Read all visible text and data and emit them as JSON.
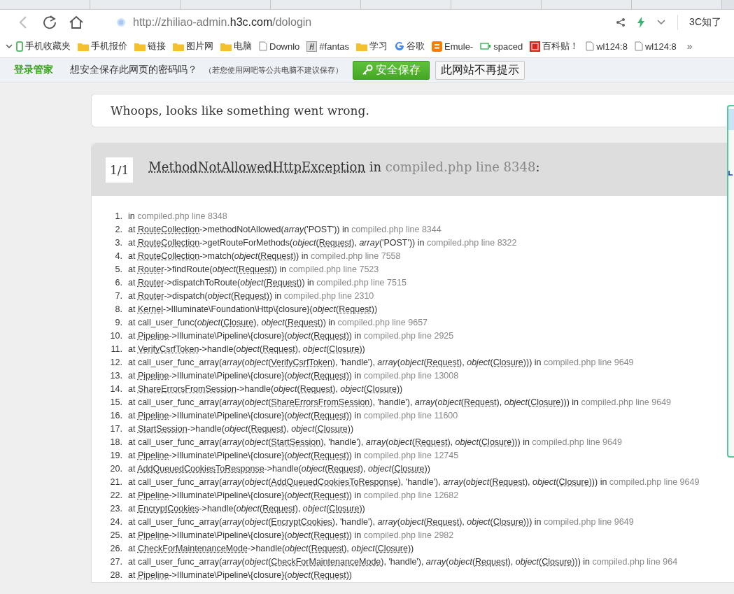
{
  "address_bar": {
    "url_scheme": "http://zhiliao-admin.",
    "url_domain": "h3c.com",
    "url_path": "/dologin",
    "search_text": "3C知了"
  },
  "bookmarks": [
    {
      "kind": "phone",
      "label": "手机收藏夹"
    },
    {
      "kind": "folder",
      "label": "手机报价"
    },
    {
      "kind": "folder",
      "label": "链接"
    },
    {
      "kind": "folder",
      "label": "图片网"
    },
    {
      "kind": "folder",
      "label": "电脑"
    },
    {
      "kind": "page",
      "label": "Downlo"
    },
    {
      "kind": "script",
      "label": "#fantas"
    },
    {
      "kind": "folder",
      "label": "学习"
    },
    {
      "kind": "google",
      "label": "谷歌"
    },
    {
      "kind": "blog",
      "label": "Emule-"
    },
    {
      "kind": "device",
      "label": "spaced"
    },
    {
      "kind": "stamp",
      "label": "百科贴！"
    },
    {
      "kind": "page",
      "label": "wl124:8"
    },
    {
      "kind": "page",
      "label": "wl124:8"
    }
  ],
  "bookmarks_more": "»",
  "password_bar": {
    "brand": "登录管家",
    "question": "想安全保存此网页的密码吗？",
    "hint": "（若您使用网吧等公共电脑不建议保存）",
    "save_button": "安全保存",
    "never_button": "此网站不再提示"
  },
  "error_page": {
    "headline": "Whoops, looks like something went wrong.",
    "counter": "1/1",
    "exception": "MethodNotAllowedHttpException",
    "exception_in": " in ",
    "exception_location": "compiled.php line 8348",
    "exception_colon": ":",
    "frames": [
      {
        "number": "1.",
        "parts": [
          {
            "kind": "plain",
            "text": "in "
          },
          {
            "kind": "file",
            "text": "compiled.php line 8348"
          }
        ]
      },
      {
        "number": "2.",
        "parts": [
          {
            "kind": "plain",
            "text": "at "
          },
          {
            "kind": "class",
            "text": "RouteCollection"
          },
          {
            "kind": "plain",
            "text": "->methodNotAllowed("
          },
          {
            "kind": "type",
            "text": "array"
          },
          {
            "kind": "plain",
            "text": "('POST')) in "
          },
          {
            "kind": "file",
            "text": "compiled.php line 8344"
          }
        ]
      },
      {
        "number": "3.",
        "parts": [
          {
            "kind": "plain",
            "text": "at "
          },
          {
            "kind": "class",
            "text": "RouteCollection"
          },
          {
            "kind": "plain",
            "text": "->getRouteForMethods("
          },
          {
            "kind": "type",
            "text": "object"
          },
          {
            "kind": "plain",
            "text": "("
          },
          {
            "kind": "class",
            "text": "Request"
          },
          {
            "kind": "plain",
            "text": "), "
          },
          {
            "kind": "type",
            "text": "array"
          },
          {
            "kind": "plain",
            "text": "('POST')) in "
          },
          {
            "kind": "file",
            "text": "compiled.php line 8322"
          }
        ]
      },
      {
        "number": "4.",
        "parts": [
          {
            "kind": "plain",
            "text": "at "
          },
          {
            "kind": "class",
            "text": "RouteCollection"
          },
          {
            "kind": "plain",
            "text": "->match("
          },
          {
            "kind": "type",
            "text": "object"
          },
          {
            "kind": "plain",
            "text": "("
          },
          {
            "kind": "class",
            "text": "Request"
          },
          {
            "kind": "plain",
            "text": ")) in "
          },
          {
            "kind": "file",
            "text": "compiled.php line 7558"
          }
        ]
      },
      {
        "number": "5.",
        "parts": [
          {
            "kind": "plain",
            "text": "at "
          },
          {
            "kind": "class",
            "text": "Router"
          },
          {
            "kind": "plain",
            "text": "->findRoute("
          },
          {
            "kind": "type",
            "text": "object"
          },
          {
            "kind": "plain",
            "text": "("
          },
          {
            "kind": "class",
            "text": "Request"
          },
          {
            "kind": "plain",
            "text": ")) in "
          },
          {
            "kind": "file",
            "text": "compiled.php line 7523"
          }
        ]
      },
      {
        "number": "6.",
        "parts": [
          {
            "kind": "plain",
            "text": "at "
          },
          {
            "kind": "class",
            "text": "Router"
          },
          {
            "kind": "plain",
            "text": "->dispatchToRoute("
          },
          {
            "kind": "type",
            "text": "object"
          },
          {
            "kind": "plain",
            "text": "("
          },
          {
            "kind": "class",
            "text": "Request"
          },
          {
            "kind": "plain",
            "text": ")) in "
          },
          {
            "kind": "file",
            "text": "compiled.php line 7515"
          }
        ]
      },
      {
        "number": "7.",
        "parts": [
          {
            "kind": "plain",
            "text": "at "
          },
          {
            "kind": "class",
            "text": "Router"
          },
          {
            "kind": "plain",
            "text": "->dispatch("
          },
          {
            "kind": "type",
            "text": "object"
          },
          {
            "kind": "plain",
            "text": "("
          },
          {
            "kind": "class",
            "text": "Request"
          },
          {
            "kind": "plain",
            "text": ")) in "
          },
          {
            "kind": "file",
            "text": "compiled.php line 2310"
          }
        ]
      },
      {
        "number": "8.",
        "parts": [
          {
            "kind": "plain",
            "text": "at "
          },
          {
            "kind": "class",
            "text": "Kernel"
          },
          {
            "kind": "plain",
            "text": "->Illuminate\\Foundation\\Http\\{closure}("
          },
          {
            "kind": "type",
            "text": "object"
          },
          {
            "kind": "plain",
            "text": "("
          },
          {
            "kind": "class",
            "text": "Request"
          },
          {
            "kind": "plain",
            "text": "))"
          }
        ]
      },
      {
        "number": "9.",
        "parts": [
          {
            "kind": "plain",
            "text": "at call_user_func("
          },
          {
            "kind": "type",
            "text": "object"
          },
          {
            "kind": "plain",
            "text": "("
          },
          {
            "kind": "class",
            "text": "Closure"
          },
          {
            "kind": "plain",
            "text": "), "
          },
          {
            "kind": "type",
            "text": "object"
          },
          {
            "kind": "plain",
            "text": "("
          },
          {
            "kind": "class",
            "text": "Request"
          },
          {
            "kind": "plain",
            "text": ")) in "
          },
          {
            "kind": "file",
            "text": "compiled.php line 9657"
          }
        ]
      },
      {
        "number": "10.",
        "parts": [
          {
            "kind": "plain",
            "text": "at "
          },
          {
            "kind": "class",
            "text": "Pipeline"
          },
          {
            "kind": "plain",
            "text": "->Illuminate\\Pipeline\\{closure}("
          },
          {
            "kind": "type",
            "text": "object"
          },
          {
            "kind": "plain",
            "text": "("
          },
          {
            "kind": "class",
            "text": "Request"
          },
          {
            "kind": "plain",
            "text": ")) in "
          },
          {
            "kind": "file",
            "text": "compiled.php line 2925"
          }
        ]
      },
      {
        "number": "11.",
        "parts": [
          {
            "kind": "plain",
            "text": "at "
          },
          {
            "kind": "class",
            "text": "VerifyCsrfToken"
          },
          {
            "kind": "plain",
            "text": "->handle("
          },
          {
            "kind": "type",
            "text": "object"
          },
          {
            "kind": "plain",
            "text": "("
          },
          {
            "kind": "class",
            "text": "Request"
          },
          {
            "kind": "plain",
            "text": "), "
          },
          {
            "kind": "type",
            "text": "object"
          },
          {
            "kind": "plain",
            "text": "("
          },
          {
            "kind": "class",
            "text": "Closure"
          },
          {
            "kind": "plain",
            "text": "))"
          }
        ]
      },
      {
        "number": "12.",
        "parts": [
          {
            "kind": "plain",
            "text": "at call_user_func_array("
          },
          {
            "kind": "type",
            "text": "array"
          },
          {
            "kind": "plain",
            "text": "("
          },
          {
            "kind": "type",
            "text": "object"
          },
          {
            "kind": "plain",
            "text": "("
          },
          {
            "kind": "class",
            "text": "VerifyCsrfToken"
          },
          {
            "kind": "plain",
            "text": "), 'handle'), "
          },
          {
            "kind": "type",
            "text": "array"
          },
          {
            "kind": "plain",
            "text": "("
          },
          {
            "kind": "type",
            "text": "object"
          },
          {
            "kind": "plain",
            "text": "("
          },
          {
            "kind": "class",
            "text": "Request"
          },
          {
            "kind": "plain",
            "text": "), "
          },
          {
            "kind": "type",
            "text": "object"
          },
          {
            "kind": "plain",
            "text": "("
          },
          {
            "kind": "class",
            "text": "Closure"
          },
          {
            "kind": "plain",
            "text": "))) in "
          },
          {
            "kind": "file",
            "text": "compiled.php line 9649"
          }
        ]
      },
      {
        "number": "13.",
        "parts": [
          {
            "kind": "plain",
            "text": "at "
          },
          {
            "kind": "class",
            "text": "Pipeline"
          },
          {
            "kind": "plain",
            "text": "->Illuminate\\Pipeline\\{closure}("
          },
          {
            "kind": "type",
            "text": "object"
          },
          {
            "kind": "plain",
            "text": "("
          },
          {
            "kind": "class",
            "text": "Request"
          },
          {
            "kind": "plain",
            "text": ")) in "
          },
          {
            "kind": "file",
            "text": "compiled.php line 13008"
          }
        ]
      },
      {
        "number": "14.",
        "parts": [
          {
            "kind": "plain",
            "text": "at "
          },
          {
            "kind": "class",
            "text": "ShareErrorsFromSession"
          },
          {
            "kind": "plain",
            "text": "->handle("
          },
          {
            "kind": "type",
            "text": "object"
          },
          {
            "kind": "plain",
            "text": "("
          },
          {
            "kind": "class",
            "text": "Request"
          },
          {
            "kind": "plain",
            "text": "), "
          },
          {
            "kind": "type",
            "text": "object"
          },
          {
            "kind": "plain",
            "text": "("
          },
          {
            "kind": "class",
            "text": "Closure"
          },
          {
            "kind": "plain",
            "text": "))"
          }
        ]
      },
      {
        "number": "15.",
        "parts": [
          {
            "kind": "plain",
            "text": "at call_user_func_array("
          },
          {
            "kind": "type",
            "text": "array"
          },
          {
            "kind": "plain",
            "text": "("
          },
          {
            "kind": "type",
            "text": "object"
          },
          {
            "kind": "plain",
            "text": "("
          },
          {
            "kind": "class",
            "text": "ShareErrorsFromSession"
          },
          {
            "kind": "plain",
            "text": "), 'handle'), "
          },
          {
            "kind": "type",
            "text": "array"
          },
          {
            "kind": "plain",
            "text": "("
          },
          {
            "kind": "type",
            "text": "object"
          },
          {
            "kind": "plain",
            "text": "("
          },
          {
            "kind": "class",
            "text": "Request"
          },
          {
            "kind": "plain",
            "text": "), "
          },
          {
            "kind": "type",
            "text": "object"
          },
          {
            "kind": "plain",
            "text": "("
          },
          {
            "kind": "class",
            "text": "Closure"
          },
          {
            "kind": "plain",
            "text": "))) in "
          },
          {
            "kind": "file",
            "text": "compiled.php line 9649"
          }
        ]
      },
      {
        "number": "16.",
        "parts": [
          {
            "kind": "plain",
            "text": "at "
          },
          {
            "kind": "class",
            "text": "Pipeline"
          },
          {
            "kind": "plain",
            "text": "->Illuminate\\Pipeline\\{closure}("
          },
          {
            "kind": "type",
            "text": "object"
          },
          {
            "kind": "plain",
            "text": "("
          },
          {
            "kind": "class",
            "text": "Request"
          },
          {
            "kind": "plain",
            "text": ")) in "
          },
          {
            "kind": "file",
            "text": "compiled.php line 11600"
          }
        ]
      },
      {
        "number": "17.",
        "parts": [
          {
            "kind": "plain",
            "text": "at "
          },
          {
            "kind": "class",
            "text": "StartSession"
          },
          {
            "kind": "plain",
            "text": "->handle("
          },
          {
            "kind": "type",
            "text": "object"
          },
          {
            "kind": "plain",
            "text": "("
          },
          {
            "kind": "class",
            "text": "Request"
          },
          {
            "kind": "plain",
            "text": "), "
          },
          {
            "kind": "type",
            "text": "object"
          },
          {
            "kind": "plain",
            "text": "("
          },
          {
            "kind": "class",
            "text": "Closure"
          },
          {
            "kind": "plain",
            "text": "))"
          }
        ]
      },
      {
        "number": "18.",
        "parts": [
          {
            "kind": "plain",
            "text": "at call_user_func_array("
          },
          {
            "kind": "type",
            "text": "array"
          },
          {
            "kind": "plain",
            "text": "("
          },
          {
            "kind": "type",
            "text": "object"
          },
          {
            "kind": "plain",
            "text": "("
          },
          {
            "kind": "class",
            "text": "StartSession"
          },
          {
            "kind": "plain",
            "text": "), 'handle'), "
          },
          {
            "kind": "type",
            "text": "array"
          },
          {
            "kind": "plain",
            "text": "("
          },
          {
            "kind": "type",
            "text": "object"
          },
          {
            "kind": "plain",
            "text": "("
          },
          {
            "kind": "class",
            "text": "Request"
          },
          {
            "kind": "plain",
            "text": "), "
          },
          {
            "kind": "type",
            "text": "object"
          },
          {
            "kind": "plain",
            "text": "("
          },
          {
            "kind": "class",
            "text": "Closure"
          },
          {
            "kind": "plain",
            "text": "))) in "
          },
          {
            "kind": "file",
            "text": "compiled.php line 9649"
          }
        ]
      },
      {
        "number": "19.",
        "parts": [
          {
            "kind": "plain",
            "text": "at "
          },
          {
            "kind": "class",
            "text": "Pipeline"
          },
          {
            "kind": "plain",
            "text": "->Illuminate\\Pipeline\\{closure}("
          },
          {
            "kind": "type",
            "text": "object"
          },
          {
            "kind": "plain",
            "text": "("
          },
          {
            "kind": "class",
            "text": "Request"
          },
          {
            "kind": "plain",
            "text": ")) in "
          },
          {
            "kind": "file",
            "text": "compiled.php line 12745"
          }
        ]
      },
      {
        "number": "20.",
        "parts": [
          {
            "kind": "plain",
            "text": "at "
          },
          {
            "kind": "class",
            "text": "AddQueuedCookiesToResponse"
          },
          {
            "kind": "plain",
            "text": "->handle("
          },
          {
            "kind": "type",
            "text": "object"
          },
          {
            "kind": "plain",
            "text": "("
          },
          {
            "kind": "class",
            "text": "Request"
          },
          {
            "kind": "plain",
            "text": "), "
          },
          {
            "kind": "type",
            "text": "object"
          },
          {
            "kind": "plain",
            "text": "("
          },
          {
            "kind": "class",
            "text": "Closure"
          },
          {
            "kind": "plain",
            "text": "))"
          }
        ]
      },
      {
        "number": "21.",
        "parts": [
          {
            "kind": "plain",
            "text": "at call_user_func_array("
          },
          {
            "kind": "type",
            "text": "array"
          },
          {
            "kind": "plain",
            "text": "("
          },
          {
            "kind": "type",
            "text": "object"
          },
          {
            "kind": "plain",
            "text": "("
          },
          {
            "kind": "class",
            "text": "AddQueuedCookiesToResponse"
          },
          {
            "kind": "plain",
            "text": "), 'handle'), "
          },
          {
            "kind": "type",
            "text": "array"
          },
          {
            "kind": "plain",
            "text": "("
          },
          {
            "kind": "type",
            "text": "object"
          },
          {
            "kind": "plain",
            "text": "("
          },
          {
            "kind": "class",
            "text": "Request"
          },
          {
            "kind": "plain",
            "text": "), "
          },
          {
            "kind": "type",
            "text": "object"
          },
          {
            "kind": "plain",
            "text": "("
          },
          {
            "kind": "class",
            "text": "Closure"
          },
          {
            "kind": "plain",
            "text": "))) in "
          },
          {
            "kind": "file",
            "text": "compiled.php line 9649"
          }
        ]
      },
      {
        "number": "22.",
        "parts": [
          {
            "kind": "plain",
            "text": "at "
          },
          {
            "kind": "class",
            "text": "Pipeline"
          },
          {
            "kind": "plain",
            "text": "->Illuminate\\Pipeline\\{closure}("
          },
          {
            "kind": "type",
            "text": "object"
          },
          {
            "kind": "plain",
            "text": "("
          },
          {
            "kind": "class",
            "text": "Request"
          },
          {
            "kind": "plain",
            "text": ")) in "
          },
          {
            "kind": "file",
            "text": "compiled.php line 12682"
          }
        ]
      },
      {
        "number": "23.",
        "parts": [
          {
            "kind": "plain",
            "text": "at "
          },
          {
            "kind": "class",
            "text": "EncryptCookies"
          },
          {
            "kind": "plain",
            "text": "->handle("
          },
          {
            "kind": "type",
            "text": "object"
          },
          {
            "kind": "plain",
            "text": "("
          },
          {
            "kind": "class",
            "text": "Request"
          },
          {
            "kind": "plain",
            "text": "), "
          },
          {
            "kind": "type",
            "text": "object"
          },
          {
            "kind": "plain",
            "text": "("
          },
          {
            "kind": "class",
            "text": "Closure"
          },
          {
            "kind": "plain",
            "text": "))"
          }
        ]
      },
      {
        "number": "24.",
        "parts": [
          {
            "kind": "plain",
            "text": "at call_user_func_array("
          },
          {
            "kind": "type",
            "text": "array"
          },
          {
            "kind": "plain",
            "text": "("
          },
          {
            "kind": "type",
            "text": "object"
          },
          {
            "kind": "plain",
            "text": "("
          },
          {
            "kind": "class",
            "text": "EncryptCookies"
          },
          {
            "kind": "plain",
            "text": "), 'handle'), "
          },
          {
            "kind": "type",
            "text": "array"
          },
          {
            "kind": "plain",
            "text": "("
          },
          {
            "kind": "type",
            "text": "object"
          },
          {
            "kind": "plain",
            "text": "("
          },
          {
            "kind": "class",
            "text": "Request"
          },
          {
            "kind": "plain",
            "text": "), "
          },
          {
            "kind": "type",
            "text": "object"
          },
          {
            "kind": "plain",
            "text": "("
          },
          {
            "kind": "class",
            "text": "Closure"
          },
          {
            "kind": "plain",
            "text": "))) in "
          },
          {
            "kind": "file",
            "text": "compiled.php line 9649"
          }
        ]
      },
      {
        "number": "25.",
        "parts": [
          {
            "kind": "plain",
            "text": "at "
          },
          {
            "kind": "class",
            "text": "Pipeline"
          },
          {
            "kind": "plain",
            "text": "->Illuminate\\Pipeline\\{closure}("
          },
          {
            "kind": "type",
            "text": "object"
          },
          {
            "kind": "plain",
            "text": "("
          },
          {
            "kind": "class",
            "text": "Request"
          },
          {
            "kind": "plain",
            "text": ")) in "
          },
          {
            "kind": "file",
            "text": "compiled.php line 2982"
          }
        ]
      },
      {
        "number": "26.",
        "parts": [
          {
            "kind": "plain",
            "text": "at "
          },
          {
            "kind": "class",
            "text": "CheckForMaintenanceMode"
          },
          {
            "kind": "plain",
            "text": "->handle("
          },
          {
            "kind": "type",
            "text": "object"
          },
          {
            "kind": "plain",
            "text": "("
          },
          {
            "kind": "class",
            "text": "Request"
          },
          {
            "kind": "plain",
            "text": "), "
          },
          {
            "kind": "type",
            "text": "object"
          },
          {
            "kind": "plain",
            "text": "("
          },
          {
            "kind": "class",
            "text": "Closure"
          },
          {
            "kind": "plain",
            "text": "))"
          }
        ]
      },
      {
        "number": "27.",
        "parts": [
          {
            "kind": "plain",
            "text": "at call_user_func_array("
          },
          {
            "kind": "type",
            "text": "array"
          },
          {
            "kind": "plain",
            "text": "("
          },
          {
            "kind": "type",
            "text": "object"
          },
          {
            "kind": "plain",
            "text": "("
          },
          {
            "kind": "class",
            "text": "CheckForMaintenanceMode"
          },
          {
            "kind": "plain",
            "text": "), 'handle'), "
          },
          {
            "kind": "type",
            "text": "array"
          },
          {
            "kind": "plain",
            "text": "("
          },
          {
            "kind": "type",
            "text": "object"
          },
          {
            "kind": "plain",
            "text": "("
          },
          {
            "kind": "class",
            "text": "Request"
          },
          {
            "kind": "plain",
            "text": "), "
          },
          {
            "kind": "type",
            "text": "object"
          },
          {
            "kind": "plain",
            "text": "("
          },
          {
            "kind": "class",
            "text": "Closure"
          },
          {
            "kind": "plain",
            "text": "))) in "
          },
          {
            "kind": "file",
            "text": "compiled.php line 964"
          }
        ]
      },
      {
        "number": "28.",
        "parts": [
          {
            "kind": "plain",
            "text": "at "
          },
          {
            "kind": "class",
            "text": "Pipeline"
          },
          {
            "kind": "plain",
            "text": "->Illuminate\\Pipeline\\{closure}("
          },
          {
            "kind": "type",
            "text": "object"
          },
          {
            "kind": "plain",
            "text": "("
          },
          {
            "kind": "class",
            "text": "Request"
          },
          {
            "kind": "plain",
            "text": "))"
          }
        ]
      }
    ]
  }
}
